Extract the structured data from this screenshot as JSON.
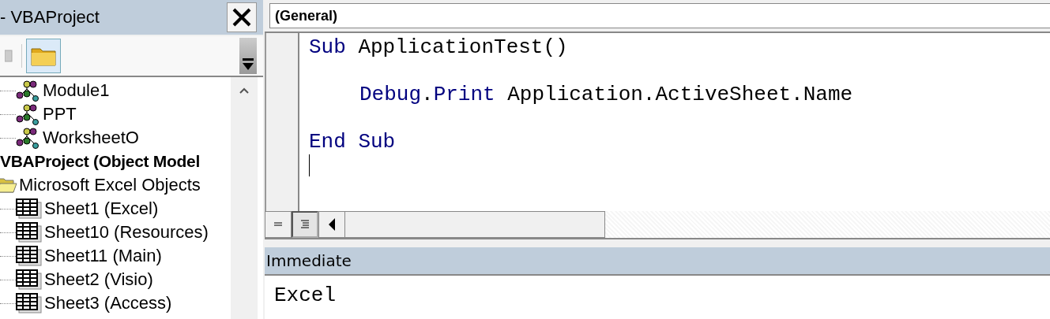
{
  "project_panel": {
    "title": "- VBAProject",
    "toolbar": [
      {
        "kind": "view-object",
        "selected": false
      },
      {
        "kind": "toggle-folders",
        "selected": true
      }
    ],
    "modules": [
      {
        "label": "Module1",
        "kind": "module"
      },
      {
        "label": "PPT",
        "kind": "module"
      },
      {
        "label": "WorksheetO",
        "kind": "module"
      }
    ],
    "project": {
      "label": "VBAProject (Object Model",
      "children": [
        {
          "label": "Microsoft Excel Objects",
          "kind": "folder",
          "expanded": true,
          "children": [
            {
              "label": "Sheet1 (Excel)",
              "kind": "sheet"
            },
            {
              "label": "Sheet10 (Resources)",
              "kind": "sheet"
            },
            {
              "label": "Sheet11 (Main)",
              "kind": "sheet"
            },
            {
              "label": "Sheet2 (Visio)",
              "kind": "sheet"
            },
            {
              "label": "Sheet3 (Access)",
              "kind": "sheet"
            }
          ]
        }
      ]
    }
  },
  "code_window": {
    "object_dropdown": "(General)",
    "lines": [
      {
        "kind": "code",
        "tokens": [
          {
            "text": "Sub",
            "kind": "keyword"
          },
          {
            "text": " ApplicationTest()",
            "kind": "plain"
          }
        ]
      },
      {
        "kind": "blank"
      },
      {
        "kind": "indented",
        "tokens": [
          {
            "text": "Debug",
            "kind": "keyword"
          },
          {
            "text": ".",
            "kind": "plain"
          },
          {
            "text": "Print",
            "kind": "keyword"
          },
          {
            "text": " Application.ActiveSheet.Name",
            "kind": "plain"
          }
        ]
      },
      {
        "kind": "blank"
      },
      {
        "kind": "code",
        "tokens": [
          {
            "text": "End Sub",
            "kind": "keyword"
          }
        ]
      },
      {
        "kind": "caret"
      }
    ],
    "view_buttons": [
      {
        "kind": "procedure",
        "selected": false
      },
      {
        "kind": "module",
        "selected": true
      }
    ]
  },
  "immediate": {
    "title": "Immediate",
    "output": "Excel"
  }
}
